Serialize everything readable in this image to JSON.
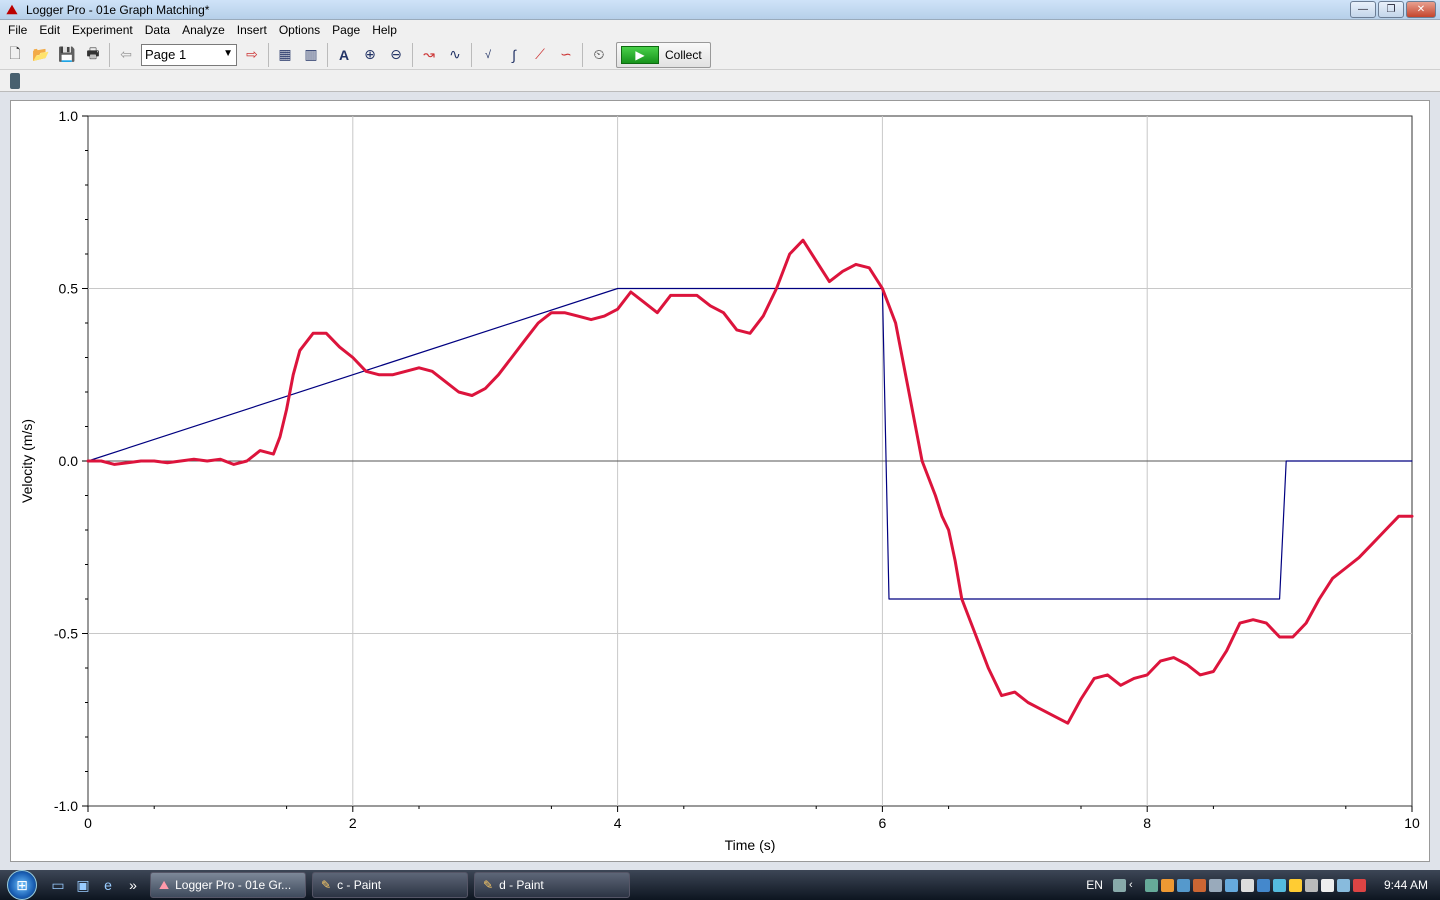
{
  "window": {
    "title": "Logger Pro - 01e Graph Matching*",
    "minimize": "—",
    "maximize": "❐",
    "close": "✕"
  },
  "menu": [
    "File",
    "Edit",
    "Experiment",
    "Data",
    "Analyze",
    "Insert",
    "Options",
    "Page",
    "Help"
  ],
  "toolbar": {
    "page_select": "Page 1",
    "collect_label": "Collect",
    "icons": [
      "new-file-icon",
      "open-file-icon",
      "save-icon",
      "print-icon",
      "page-back-icon",
      "page-forward-icon",
      "table-icon",
      "autoscale-icon",
      "zoom-in-icon",
      "zoom-out-icon",
      "examine-icon",
      "tangent-icon",
      "statistics-icon",
      "integral-icon",
      "linear-fit-icon",
      "curve-fit-icon",
      "data-collection-icon"
    ]
  },
  "chart_data": {
    "type": "line",
    "title": "",
    "xlabel": "Time (s)",
    "ylabel": "Velocity (m/s)",
    "xlim": [
      0,
      10
    ],
    "ylim": [
      -1.0,
      1.0
    ],
    "x_ticks": [
      "0",
      "2",
      "4",
      "6",
      "8",
      "10"
    ],
    "y_ticks": [
      "1.0",
      "0.5",
      "0.0",
      "-0.5",
      "-1.0"
    ],
    "grid": true,
    "series": [
      {
        "color": "#000080",
        "x": [
          0,
          4,
          6,
          6.05,
          9,
          9.05,
          10
        ],
        "y": [
          0,
          0.5,
          0.5,
          -0.4,
          -0.4,
          0.0,
          0.0
        ]
      },
      {
        "color": "#dc143c",
        "x": [
          0,
          0.1,
          0.2,
          0.3,
          0.4,
          0.5,
          0.6,
          0.7,
          0.8,
          0.9,
          1.0,
          1.1,
          1.2,
          1.3,
          1.4,
          1.45,
          1.5,
          1.55,
          1.6,
          1.7,
          1.8,
          1.9,
          2.0,
          2.1,
          2.2,
          2.3,
          2.4,
          2.5,
          2.6,
          2.7,
          2.8,
          2.9,
          3.0,
          3.1,
          3.2,
          3.3,
          3.4,
          3.5,
          3.6,
          3.7,
          3.8,
          3.9,
          4.0,
          4.1,
          4.2,
          4.3,
          4.4,
          4.5,
          4.6,
          4.7,
          4.8,
          4.9,
          5.0,
          5.1,
          5.2,
          5.3,
          5.4,
          5.5,
          5.6,
          5.7,
          5.8,
          5.9,
          6.0,
          6.1,
          6.2,
          6.3,
          6.4,
          6.45,
          6.5,
          6.55,
          6.6,
          6.7,
          6.8,
          6.9,
          7.0,
          7.1,
          7.2,
          7.3,
          7.4,
          7.5,
          7.6,
          7.7,
          7.8,
          7.9,
          8.0,
          8.1,
          8.2,
          8.3,
          8.4,
          8.5,
          8.6,
          8.7,
          8.8,
          8.9,
          9.0,
          9.1,
          9.2,
          9.3,
          9.4,
          9.5,
          9.6,
          9.7,
          9.8,
          9.9,
          10.0
        ],
        "y": [
          0.0,
          0.0,
          -0.01,
          -0.005,
          0.0,
          0.0,
          -0.005,
          0.0,
          0.005,
          0.0,
          0.005,
          -0.01,
          0.0,
          0.03,
          0.02,
          0.07,
          0.15,
          0.25,
          0.32,
          0.37,
          0.37,
          0.33,
          0.3,
          0.26,
          0.25,
          0.25,
          0.26,
          0.27,
          0.26,
          0.23,
          0.2,
          0.19,
          0.21,
          0.25,
          0.3,
          0.35,
          0.4,
          0.43,
          0.43,
          0.42,
          0.41,
          0.42,
          0.44,
          0.49,
          0.46,
          0.43,
          0.48,
          0.48,
          0.48,
          0.45,
          0.43,
          0.38,
          0.37,
          0.42,
          0.5,
          0.6,
          0.64,
          0.58,
          0.52,
          0.55,
          0.57,
          0.56,
          0.5,
          0.4,
          0.2,
          0.0,
          -0.1,
          -0.16,
          -0.2,
          -0.29,
          -0.4,
          -0.5,
          -0.6,
          -0.68,
          -0.67,
          -0.7,
          -0.72,
          -0.74,
          -0.76,
          -0.69,
          -0.63,
          -0.62,
          -0.65,
          -0.63,
          -0.62,
          -0.58,
          -0.57,
          -0.59,
          -0.62,
          -0.61,
          -0.55,
          -0.47,
          -0.46,
          -0.47,
          -0.51,
          -0.51,
          -0.47,
          -0.4,
          -0.34,
          -0.31,
          -0.28,
          -0.24,
          -0.2,
          -0.16,
          -0.16
        ]
      }
    ]
  },
  "taskbar": {
    "tasks": [
      {
        "label": "Logger Pro - 01e Gr...",
        "active": true
      },
      {
        "label": "c - Paint",
        "active": false
      },
      {
        "label": "d - Paint",
        "active": false
      }
    ],
    "language": "EN",
    "clock": "9:44 AM"
  }
}
